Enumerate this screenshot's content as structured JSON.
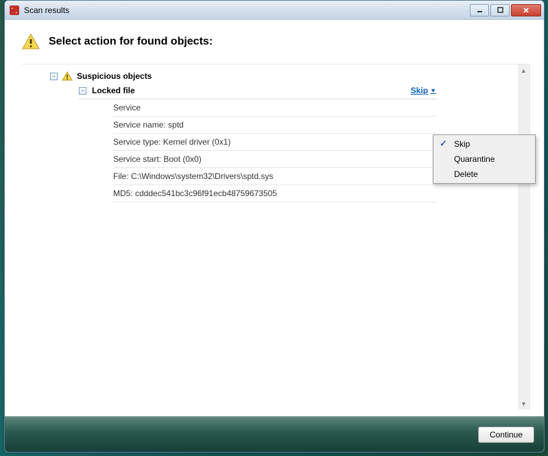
{
  "window": {
    "title": "Scan results",
    "controls": {
      "minimize": "minimize",
      "maximize": "maximize",
      "close": "close"
    }
  },
  "header": {
    "title": "Select action for found objects:"
  },
  "tree": {
    "category_label": "Suspicious objects",
    "item": {
      "label": "Locked file",
      "action_label": "Skip",
      "details": [
        "Service",
        "Service name: sptd",
        "Service type: Kernel driver (0x1)",
        "Service start: Boot (0x0)",
        "File: C:\\Windows\\system32\\Drivers\\sptd.sys",
        "MD5: cdddec541bc3c96f91ecb48759673505"
      ]
    }
  },
  "dropdown": {
    "options": [
      "Skip",
      "Quarantine",
      "Delete"
    ],
    "selected_index": 0
  },
  "footer": {
    "continue_label": "Continue"
  }
}
